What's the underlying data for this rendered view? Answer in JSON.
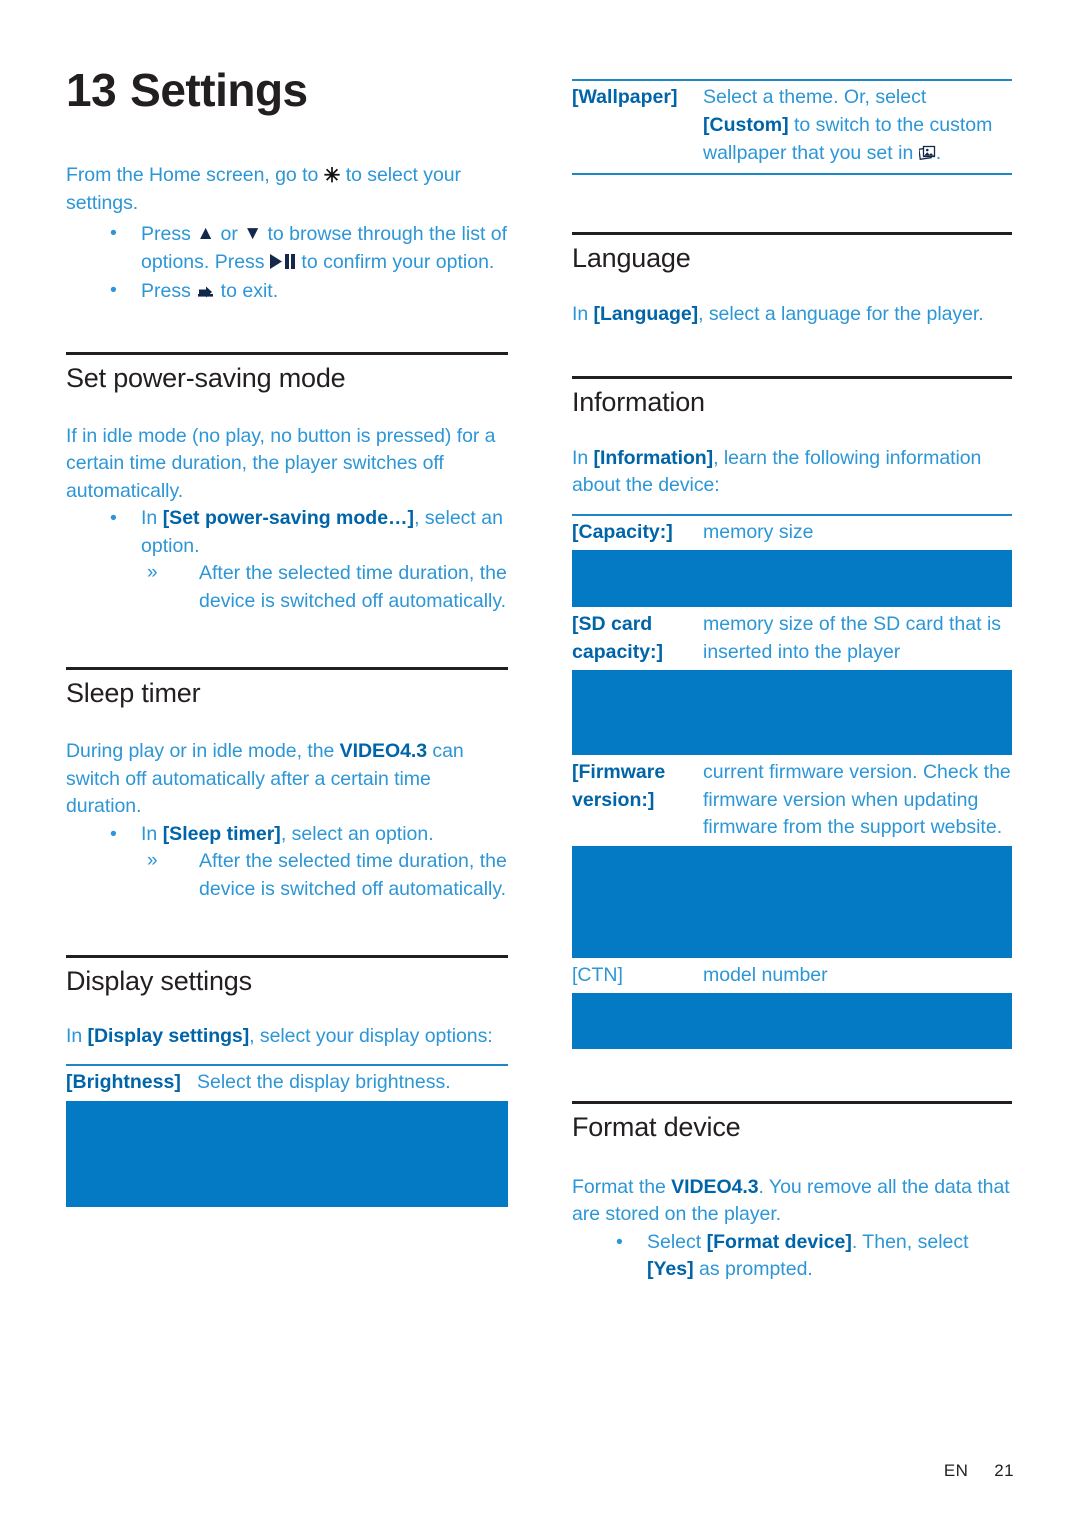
{
  "chapter": {
    "number": "13",
    "title": "Settings"
  },
  "intro": {
    "lead_before_icon": "From the Home screen, go to ",
    "lead_after_icon": " to select your settings.",
    "bullets": [
      {
        "marker": "•",
        "parts": [
          "Press ",
          "▲",
          " or ",
          "▼",
          " to browse through the list of options. Press ",
          "▶❙❙",
          " to confirm your option."
        ]
      },
      {
        "marker": "•",
        "parts": [
          "Press ",
          "back-arrow",
          " to exit."
        ]
      }
    ]
  },
  "sections": {
    "power_saving": {
      "heading": "Set power-saving mode",
      "paragraph": "If in idle mode (no play, no button is pressed) for a certain time duration, the player switches off automatically.",
      "bullet_marker": "•",
      "bullet_prefix": "In ",
      "bullet_term": "[Set power-saving mode…]",
      "bullet_suffix": ", select an option.",
      "sub_marker": "»",
      "sub_text": "After the selected time duration, the device is switched off automatically."
    },
    "sleep_timer": {
      "heading": "Sleep timer",
      "para_prefix": "During play or in idle mode, the ",
      "para_term": "VIDEO4.3",
      "para_suffix": " can switch off automatically after a certain time duration.",
      "bullet_marker": "•",
      "bullet_prefix": "In ",
      "bullet_term": "[Sleep timer]",
      "bullet_suffix": ", select an option.",
      "sub_marker": "»",
      "sub_text": "After the selected time duration, the device is switched off automatically."
    },
    "display_settings": {
      "heading": "Display settings",
      "intro_prefix": "In ",
      "intro_term": "[Display settings]",
      "intro_suffix": ", select your display options:",
      "rows": [
        {
          "key": "[Brightness]",
          "value": "Select the display brightness."
        }
      ]
    },
    "wallpaper_row": {
      "key": "[Wallpaper]",
      "value_part1": "Select a theme. Or, select ",
      "value_term": "[Custom]",
      "value_part2": " to switch to the custom wallpaper that you set in ",
      "value_icon": "photos-icon",
      "value_end": "."
    },
    "language": {
      "heading": "Language",
      "para_prefix": "In ",
      "para_term": "[Language]",
      "para_suffix": ", select a language for the player."
    },
    "information": {
      "heading": "Information",
      "intro_prefix": "In ",
      "intro_term": "[Information]",
      "intro_suffix": ", learn the following information about the device:",
      "rows": [
        {
          "key": "[Capacity:]",
          "value": "memory size",
          "bold_key": true
        },
        {
          "key": "[SD card capacity:]",
          "value": "memory size of the SD card that is inserted into the player",
          "bold_key": true
        },
        {
          "key": "[Firmware version:]",
          "value": "current firmware version. Check the firmware version when updating firmware from the support website.",
          "bold_key": true
        },
        {
          "key": "[CTN]",
          "value": "model number",
          "bold_key": false
        }
      ]
    },
    "format_device": {
      "heading": "Format device",
      "para_prefix": "Format the ",
      "para_term": "VIDEO4.3",
      "para_suffix": ". You remove all the data that are stored on the player.",
      "bullet_marker": "•",
      "bullet_prefix": "Select ",
      "bullet_term1": "[Format device]",
      "bullet_mid": ". Then, select ",
      "bullet_term2": "[Yes]",
      "bullet_suffix": " as prompted."
    }
  },
  "footer": {
    "language_code": "EN",
    "page_number": "21"
  },
  "colors": {
    "accent_blue": "#0479c4",
    "body_blue": "#2c96d6",
    "term_blue": "#0064a9",
    "heading_black": "#231f20"
  }
}
